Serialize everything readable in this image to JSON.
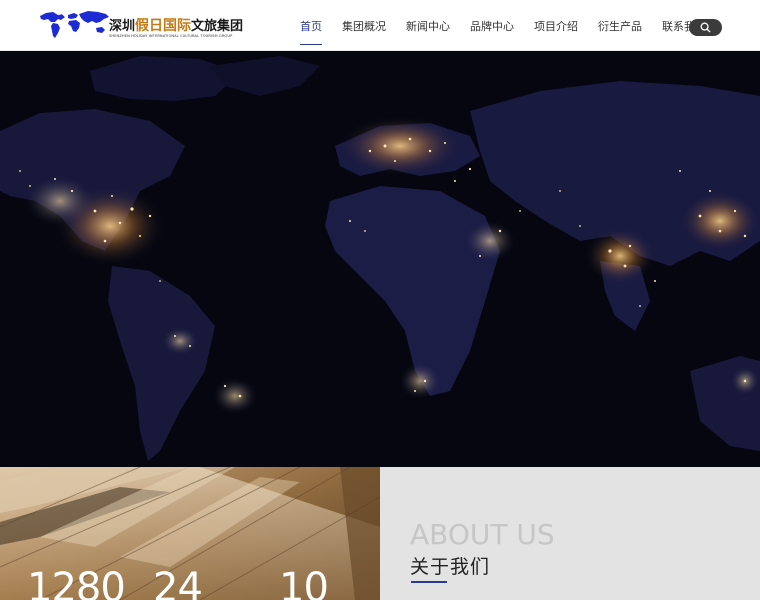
{
  "header": {
    "logo": {
      "brand_prefix": "深圳",
      "brand_accent": "假日国际",
      "brand_suffix": "文旅集团",
      "tagline": "SHENZHEN HOLIDAY INTERNATIONAL CULTURAL TOURISM GROUP",
      "mark_color": "#1d2bd4"
    },
    "nav": [
      {
        "label": "首页",
        "active": true
      },
      {
        "label": "集团概况",
        "active": false
      },
      {
        "label": "新闻中心",
        "active": false
      },
      {
        "label": "品牌中心",
        "active": false
      },
      {
        "label": "项目介绍",
        "active": false
      },
      {
        "label": "衍生产品",
        "active": false
      },
      {
        "label": "联系我们",
        "active": false
      }
    ],
    "search_icon": "search-icon",
    "accent_color": "#2a3a8c"
  },
  "stats": [
    {
      "value": "1280"
    },
    {
      "value": "24"
    },
    {
      "value": "10"
    }
  ],
  "about": {
    "title_en": "ABOUT US",
    "title_cn": "关于我们"
  }
}
